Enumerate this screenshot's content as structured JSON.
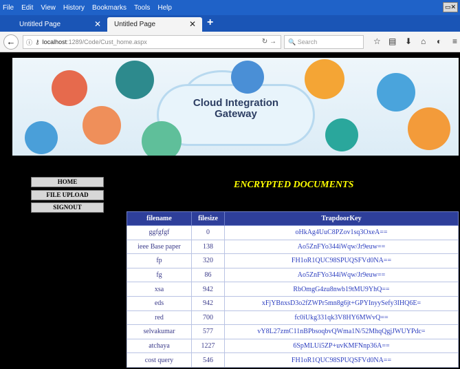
{
  "browser": {
    "menu": [
      "File",
      "Edit",
      "View",
      "History",
      "Bookmarks",
      "Tools",
      "Help"
    ],
    "tabs": [
      {
        "label": "Untitled Page",
        "active": false
      },
      {
        "label": "Untitled Page",
        "active": true
      }
    ],
    "url_host": "localhost",
    "url_path": ":1289/Code/Cust_home.aspx",
    "search_placeholder": "Search"
  },
  "banner": {
    "line1": "Cloud Integration",
    "line2": "Gateway"
  },
  "sidebar": {
    "items": [
      "HOME",
      "FILE UPLOAD",
      "SIGNOUT"
    ]
  },
  "page_title": "ENCRYPTED DOCUMENTS",
  "table": {
    "headers": [
      "filename",
      "filesize",
      "TrapdoorKey"
    ],
    "rows": [
      [
        "ggfgfgf",
        "0",
        "oHkAg4UuC8PZov1sq3OxeA=="
      ],
      [
        "ieee Base paper",
        "138",
        "Ao5ZnFYo344iWqw/Jr9euw=="
      ],
      [
        "fp",
        "320",
        "FH1oR1QUC98SPUQSFVd0NA=="
      ],
      [
        "fg",
        "86",
        "Ao5ZnFYo344iWqw/Jr9euw=="
      ],
      [
        "xsa",
        "942",
        "RbOmgG4zu8nwb19tMU9YhQ=="
      ],
      [
        "eds",
        "942",
        "xFjYBnxsD3o2fZWPr5mn8g6jt+GPYInyySefy3IHQ6E="
      ],
      [
        "red",
        "700",
        "fc0iUkg331qk3V8HY6MWvQ=="
      ],
      [
        "selvakumar",
        "577",
        "vY8L27zmC11nBPbsoqbvQWma1N/52MhqQgjJWUYPdc="
      ],
      [
        "atchaya",
        "1227",
        "6SpMLUi5ZP+uvKMFNnp36A=="
      ],
      [
        "cost query",
        "546",
        "FH1oR1QUC98SPUQSFVd0NA=="
      ]
    ]
  },
  "colors": {
    "title_yellow": "#ffff00",
    "table_header": "#2e3f9a",
    "menubar_blue": "#1f62c8"
  }
}
